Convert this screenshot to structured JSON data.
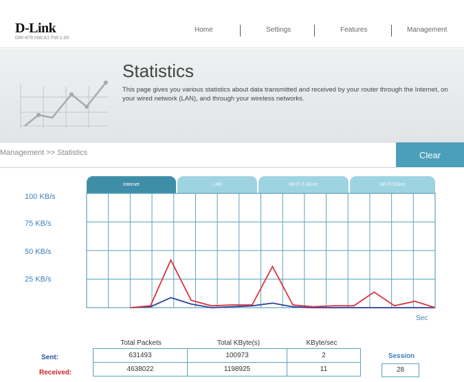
{
  "header": {
    "brand": "D-Link",
    "model": "DIR-878 HW:A1 FW:1.00",
    "nav": [
      "Home",
      "Settings",
      "Features",
      "Management"
    ]
  },
  "banner": {
    "title": "Statistics",
    "description": "This page gives you various statistics about data transmitted and received by your router through the Internet, on your wired network (LAN), and through your wireless networks."
  },
  "breadcrumb": "Management >> Statistics",
  "clear_label": "Clear",
  "tabs": [
    {
      "label": "Internet",
      "active": true
    },
    {
      "label": "LAN",
      "active": false
    },
    {
      "label": "Wi-Fi 2.4GHz",
      "active": false
    },
    {
      "label": "Wi-Fi 5GHz",
      "active": false
    }
  ],
  "graph": {
    "y_labels": [
      "100 KB/s",
      "75 KB/s",
      "50 KB/s",
      "25 KB/s"
    ],
    "x_unit": "Sec",
    "colors": {
      "grid": "#5aa3b8",
      "received": "#d8323c",
      "sent": "#2f3f9a"
    },
    "y_max": 125,
    "points": 16,
    "received": [
      0,
      2,
      52,
      8,
      2,
      3,
      3,
      45,
      3,
      1,
      2,
      2,
      17,
      2,
      7,
      0
    ],
    "sent": [
      0,
      1,
      11,
      4,
      0,
      1,
      2,
      5,
      1,
      0,
      0,
      0,
      0,
      0,
      0,
      0
    ]
  },
  "stats": {
    "headers": [
      "Total Packets",
      "Total KByte(s)",
      "KByte/sec"
    ],
    "sent_label": "Sent:",
    "received_label": "Received:",
    "sent": [
      "631493",
      "100973",
      "2"
    ],
    "received": [
      "4638022",
      "1198925",
      "11"
    ],
    "session_label": "Session",
    "session_value": "28"
  }
}
